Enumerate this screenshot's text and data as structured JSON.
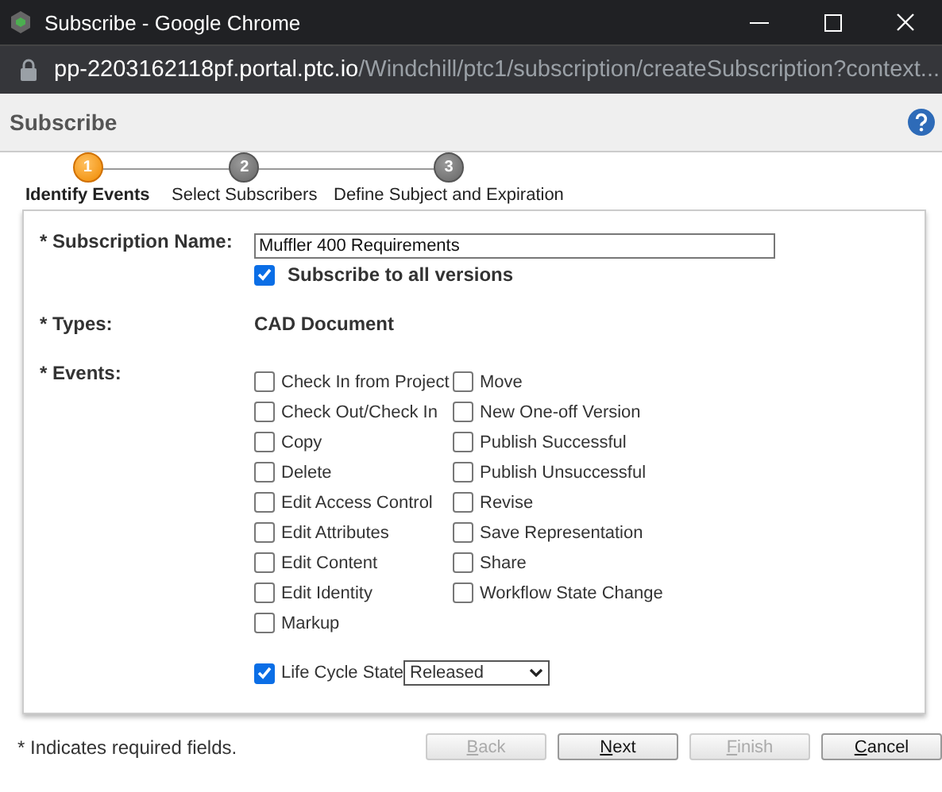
{
  "window": {
    "title": "Subscribe - Google Chrome"
  },
  "address": {
    "host": "pp-2203162118pf.portal.ptc.io",
    "path": "/Windchill/ptc1/subscription/createSubscription?context..."
  },
  "header": {
    "title": "Subscribe"
  },
  "steps": [
    {
      "number": "1",
      "label": "Identify Events",
      "selected": true
    },
    {
      "number": "2",
      "label": "Select Subscribers",
      "selected": false
    },
    {
      "number": "3",
      "label": "Define Subject and Expiration",
      "selected": false
    }
  ],
  "form": {
    "name_label": "* Subscription Name:",
    "name_value": "Muffler 400 Requirements",
    "all_versions": {
      "label": "Subscribe to all versions",
      "checked": true
    },
    "types_label": "* Types:",
    "types_value": "CAD Document",
    "events_label": "* Events:",
    "events_left": [
      {
        "label": "Check In from Project",
        "checked": false
      },
      {
        "label": "Check Out/Check In",
        "checked": false
      },
      {
        "label": "Copy",
        "checked": false
      },
      {
        "label": "Delete",
        "checked": false
      },
      {
        "label": "Edit Access Control",
        "checked": false
      },
      {
        "label": "Edit Attributes",
        "checked": false
      },
      {
        "label": "Edit Content",
        "checked": false
      },
      {
        "label": "Edit Identity",
        "checked": false
      },
      {
        "label": "Markup",
        "checked": false
      }
    ],
    "events_right": [
      {
        "label": "Move",
        "checked": false
      },
      {
        "label": "New One-off Version",
        "checked": false
      },
      {
        "label": "Publish Successful",
        "checked": false
      },
      {
        "label": "Publish Unsuccessful",
        "checked": false
      },
      {
        "label": "Revise",
        "checked": false
      },
      {
        "label": "Save Representation",
        "checked": false
      },
      {
        "label": "Share",
        "checked": false
      },
      {
        "label": "Workflow State Change",
        "checked": false
      }
    ],
    "life_cycle": {
      "label": "Life Cycle State",
      "checked": true,
      "value": "Released"
    }
  },
  "footer": {
    "note": "* Indicates required fields.",
    "buttons": [
      {
        "label": "Back",
        "disabled": true
      },
      {
        "label": "Next",
        "disabled": false
      },
      {
        "label": "Finish",
        "disabled": true
      },
      {
        "label": "Cancel",
        "disabled": false
      }
    ]
  }
}
